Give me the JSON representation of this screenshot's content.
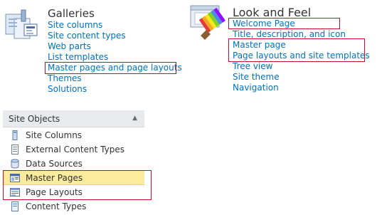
{
  "galleries": {
    "heading": "Galleries",
    "icon": "galleries-icon",
    "links": [
      "Site columns",
      "Site content types",
      "Web parts",
      "List templates",
      "Master pages and page layouts",
      "Themes",
      "Solutions"
    ]
  },
  "look_and_feel": {
    "heading": "Look and Feel",
    "icon": "look-and-feel-icon",
    "links": [
      "Welcome Page",
      "Title, description, and icon",
      "Master page",
      "Page layouts and site templates",
      "Tree view",
      "Site theme",
      "Navigation"
    ]
  },
  "site_objects": {
    "title": "Site Objects",
    "collapse_icon": "chevron-up-icon",
    "items": [
      {
        "label": "Site Columns",
        "icon": "site-columns-icon",
        "selected": false
      },
      {
        "label": "External Content Types",
        "icon": "external-content-types-icon",
        "selected": false
      },
      {
        "label": "Data Sources",
        "icon": "data-sources-icon",
        "selected": false
      },
      {
        "label": "Master Pages",
        "icon": "master-pages-icon",
        "selected": true
      },
      {
        "label": "Page Layouts",
        "icon": "page-layouts-icon",
        "selected": false
      },
      {
        "label": "Content Types",
        "icon": "content-types-icon",
        "selected": false
      }
    ]
  },
  "colors": {
    "link": "#0072bc",
    "highlight_border": "#c8102e",
    "selected_row": "#fbeb9c",
    "panel_header": "#e9eaed"
  }
}
